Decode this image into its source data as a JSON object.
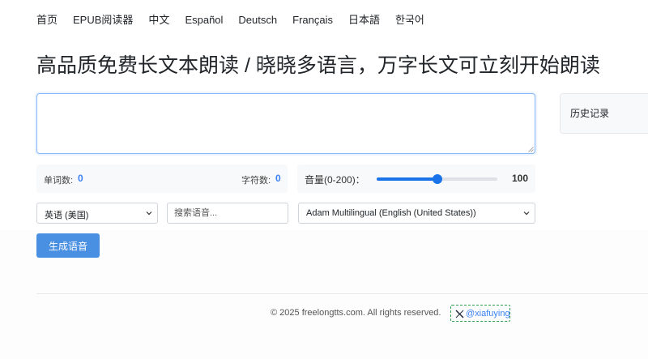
{
  "nav": {
    "items": [
      "首页",
      "EPUB阅读器",
      "中文",
      "Español",
      "Deutsch",
      "Français",
      "日本語",
      "한국어"
    ]
  },
  "page_title": "高品质免费长文本朗读 / 晓晓多语言，万字长文可立刻开始朗读",
  "history": {
    "label": "历史记录"
  },
  "stats": {
    "word_label": "单词数:",
    "word_count": "0",
    "char_label": "字符数:",
    "char_count": "0"
  },
  "volume": {
    "label": "音量(0-200)：",
    "value": "100",
    "level_fraction": 0.5
  },
  "language_select": {
    "selected": "英语 (美国)"
  },
  "voice_search": {
    "placeholder": "搜索语音..."
  },
  "voice_select": {
    "selected": "Adam Multilingual (English (United States))"
  },
  "generate_button": {
    "label": "生成语音"
  },
  "footer": {
    "copyright": "© 2025 freelongtts.com. All rights reserved.",
    "x_handle": "@xiafuying"
  },
  "colors": {
    "accent": "#4a90e2",
    "slider": "#1a73e8",
    "link": "#3b82f6"
  }
}
